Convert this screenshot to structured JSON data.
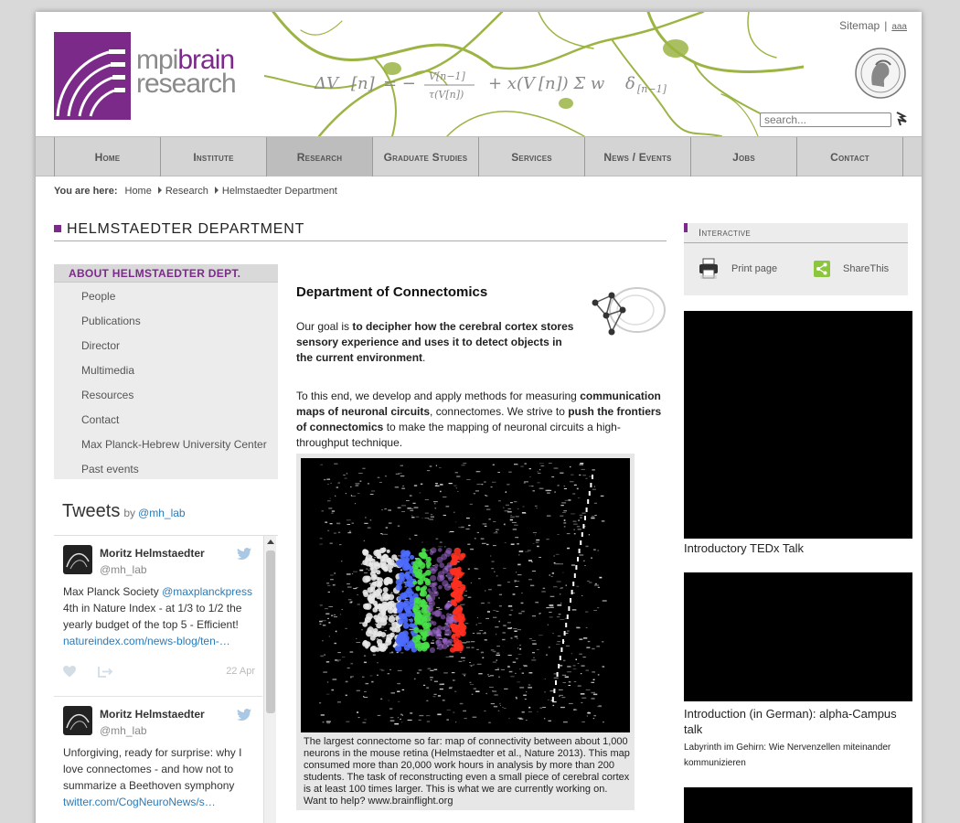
{
  "header": {
    "logo_mpi": "mpi",
    "logo_brain": "brain",
    "logo_research": "research",
    "sitemap": "Sitemap",
    "separator": "|",
    "text_size": "aaa",
    "search_placeholder": "search..."
  },
  "nav": {
    "items": [
      "Home",
      "Institute",
      "Research",
      "Graduate Studies",
      "Services",
      "News / Events",
      "Jobs",
      "Contact"
    ],
    "active": "Research"
  },
  "breadcrumb": {
    "label": "You are here:",
    "items": [
      "Home",
      "Research",
      "Helmstaedter Department"
    ]
  },
  "section_title": "HELMSTAEDTER DEPARTMENT",
  "subnav": {
    "heading": "ABOUT HELMSTAEDTER DEPT.",
    "items": [
      "People",
      "Publications",
      "Director",
      "Multimedia",
      "Resources",
      "Contact",
      "Max Planck-Hebrew University Center",
      "Past events"
    ]
  },
  "tweets": {
    "title": "Tweets",
    "by": "by",
    "handle": "@mh_lab",
    "items": [
      {
        "name": "Moritz Helmstaedter",
        "handle": "@mh_lab",
        "text_1": "Max Planck Society",
        "mention": "@maxplanckpress",
        "text_2": "4th in Nature Index - at 1/3 to 1/2 the yearly budget of the top 5 - Efficient!",
        "link": "natureindex.com/news-blog/ten-…",
        "date": "22 Apr"
      },
      {
        "name": "Moritz Helmstaedter",
        "handle": "@mh_lab",
        "text_1": "Unforgiving, ready for surprise: why I love connectomes - and how not to summarize a Beethoven symphony",
        "link": "twitter.com/CogNeuroNews/s…"
      }
    ]
  },
  "main": {
    "heading": "Department of Connectomics",
    "p1_a": "Our goal is ",
    "p1_b": "to decipher how the cerebral cortex stores sensory experience and uses it to detect objects in the current environment",
    "p1_c": ".",
    "p2_a": "To this end, we develop and apply methods for measuring ",
    "p2_b": "communication maps of neuronal circuits",
    "p2_c": ", connectomes. We strive to ",
    "p2_d": "push the frontiers of connectomics",
    "p2_e": " to make the mapping of neuronal circuits a high-throughput technique.",
    "caption": "The largest connectome so far: map of connectivity between about 1,000 neurons in the mouse retina (Helmstaedter et al., Nature 2013). This map consumed more than 20,000 work hours in analysis by more than 200 students. The task of reconstructing even a small piece of cerebral cortex is at least 100 times larger. This is what we are currently working on. Want to help? www.brainflight.org"
  },
  "interactive": {
    "heading": "Interactive",
    "print": "Print page",
    "share": "ShareThis"
  },
  "videos": [
    {
      "title": "Introductory TEDx Talk"
    },
    {
      "title": "Introduction (in German): alpha-Campus talk",
      "subtitle": "Labyrinth im Gehirn: Wie Nervenzellen miteinander kommunizieren"
    },
    {
      "title": ""
    }
  ],
  "colors": {
    "brand_purple": "#7b2a8a",
    "link_blue": "#2a7ab8",
    "nav_bg": "#d4d4d4",
    "neuron_green": "#9bb443"
  }
}
